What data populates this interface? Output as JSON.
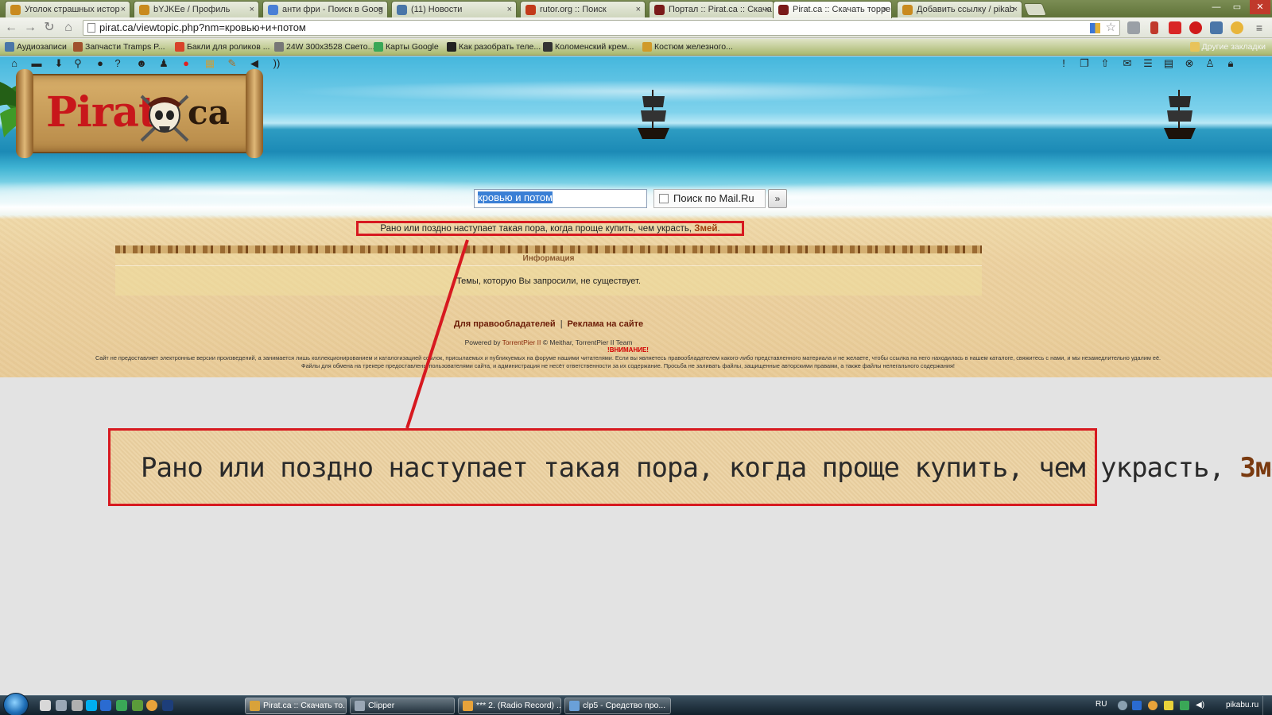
{
  "browser": {
    "tabs": [
      {
        "title": "Уголок страшных истор",
        "favicon_color": "#c98a1e"
      },
      {
        "title": "bYJKEe / Профиль",
        "favicon_color": "#c98a1e"
      },
      {
        "title": "анти фри - Поиск в Goog",
        "favicon_color": "#4a7fd6"
      },
      {
        "title": "(11) Новости",
        "favicon_color": "#4a76a8"
      },
      {
        "title": "rutor.org :: Поиск",
        "favicon_color": "#c23a1a"
      },
      {
        "title": "Портал :: Pirat.ca :: Скача",
        "favicon_color": "#7a1a1a"
      },
      {
        "title": "Pirat.ca :: Скачать торрен",
        "favicon_color": "#7a1a1a",
        "active": true
      },
      {
        "title": "Добавить ссылку / pikab",
        "favicon_color": "#c98a1e"
      }
    ],
    "close_glyph": "×",
    "window_buttons": [
      "—",
      "▭",
      "✕"
    ],
    "nav": {
      "back": "←",
      "forward": "→",
      "reload": "↻",
      "home": "⌂"
    },
    "url": "pirat.ca/viewtopic.php?nm=кровью+и+потом",
    "star": "☆",
    "bookmarks": [
      {
        "label": "Аудиозаписи",
        "icon_color": "#4a76a8"
      },
      {
        "label": "Запчасти Tramps P...",
        "icon_color": "#a0522d"
      },
      {
        "label": "Бакли для роликов ...",
        "icon_color": "#d8432a"
      },
      {
        "label": "24W 300x3528 Свето...",
        "icon_color": "#777777"
      },
      {
        "label": "Карты Google",
        "icon_color": "#3aa757"
      },
      {
        "label": "Как разобрать теле...",
        "icon_color": "#222222"
      },
      {
        "label": "Коломенский крем...",
        "icon_color": "#333333"
      },
      {
        "label": "Костюм железного...",
        "icon_color": "#d09a2a"
      }
    ],
    "other_bookmarks": "Другие закладки"
  },
  "site": {
    "logo": {
      "left": "Pirat",
      "right": "ca"
    },
    "icons_left": [
      "home-icon",
      "chat-icon",
      "download-icon",
      "search-icon",
      "circle-icon",
      "help-icon",
      "users-icon",
      "group-icon",
      "record-icon",
      "calendar-icon",
      "edit-icon",
      "speaker-icon",
      "rss-icon"
    ],
    "icons_right": [
      "alert-icon",
      "copy-icon",
      "upload-icon",
      "mail-icon",
      "list-icon",
      "document-icon",
      "close-icon",
      "user-icon",
      "lock-icon"
    ],
    "search": {
      "query": "кровью и потом",
      "mailru_label": "Поиск по Mail.Ru",
      "go_label": "»"
    },
    "quote": {
      "text": "Рано или поздно наступает такая пора, когда проще купить, чем украсть,",
      "author": "Змей",
      "end": "."
    },
    "info": {
      "title": "Информация",
      "message": "Темы, которую Вы запросили, не существует."
    },
    "footer": {
      "link1": "Для правообладателей",
      "separator": "|",
      "link2": "Реклама на сайте",
      "powered_prefix": "Powered by",
      "powered_engine": "TorrentPier II",
      "powered_suffix": "© Meithar, TorrentPier II Team",
      "warning": "!ВНИМАНИЕ!",
      "disclaimer1": "Сайт не предоставляет электронные версии произведений, а занимается лишь коллекционированием и каталогизацией ссылок, присылаемых и публикуемых на форуме нашими читателями. Если вы являетесь правообладателем какого-либо представленного материала и не желаете, чтобы ссылка на него находилась в нашем каталоге, свяжитесь с нами, и мы незамедлительно удалим её.",
      "disclaimer2": "Файлы для обмена на трекере предоставлены пользователями сайта, и администрация не несёт ответственности за их содержание. Просьба не заливать файлы, защищенные авторскими правами, а также файлы нелегального содержания!"
    }
  },
  "annotation": {
    "zoom_text": "Рано или поздно наступает такая пора, когда проще купить, чем украсть,",
    "zoom_author": "Змей",
    "zoom_end": "."
  },
  "taskbar": {
    "tasks": [
      {
        "label": "Pirat.ca :: Скачать то...",
        "icon_color": "#d8a23a",
        "active": true
      },
      {
        "label": "Clipper",
        "icon_color": "#9aa7b5"
      },
      {
        "label": "*** 2. (Radio Record) ...",
        "icon_color": "#e8a33a"
      },
      {
        "label": "clp5 - Средство про...",
        "icon_color": "#6aa0d8"
      }
    ],
    "lang": "RU",
    "watermark": "pikabu.ru"
  }
}
